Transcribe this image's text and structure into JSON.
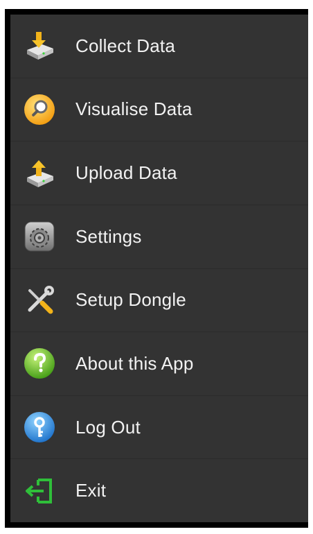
{
  "menu": {
    "items": [
      {
        "label": "Collect Data",
        "icon": "collect-data-icon"
      },
      {
        "label": "Visualise Data",
        "icon": "magnifier-icon"
      },
      {
        "label": "Upload Data",
        "icon": "upload-data-icon"
      },
      {
        "label": "Settings",
        "icon": "gear-icon"
      },
      {
        "label": "Setup Dongle",
        "icon": "tools-icon"
      },
      {
        "label": "About this App",
        "icon": "help-icon"
      },
      {
        "label": "Log Out",
        "icon": "key-icon"
      },
      {
        "label": "Exit",
        "icon": "exit-icon"
      }
    ]
  },
  "colors": {
    "background": "#333333",
    "frame": "#000000",
    "text": "#f2f2f2",
    "divider": "#2b2b2b"
  }
}
